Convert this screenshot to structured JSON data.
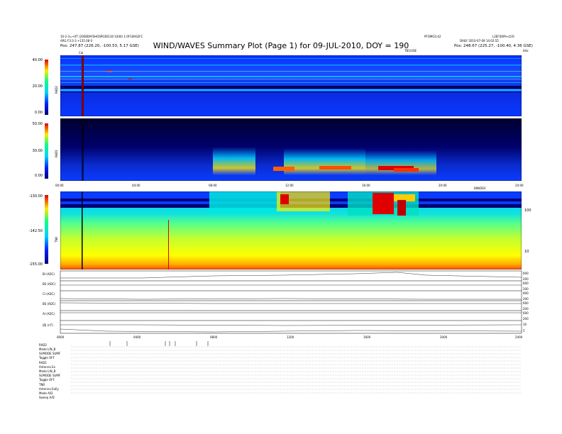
{
  "header": {
    "title": "WIND/WAVES Summary Plot (Page 1) for 09-JUL-2010, DOY = 190",
    "left_line1": "10-2-3=+0T (2008DAYSHOSP03D130 S300) 1:0F10HS2FC",
    "left_line2": "ARG F3:3-3 +135 08 0",
    "left_pos": "Pos: 247.87 (226.20, -100.53, 5.17 GSE)",
    "right_top_a": "PFOMO3.42",
    "right_top_b": "L2EF0OM+s5/0",
    "right_line2": "DAILY 2010-07-09 14:02:55",
    "right_pos": "Pos: 248.67 (225.27, -100.40, 4.36 GSE)",
    "tb_label": "TB1/USE",
    "khz_label": "kHz"
  },
  "panels": {
    "rad2": {
      "name": "RAD2",
      "ticks": [
        "40.00",
        "20.00",
        "0.00"
      ],
      "cal": "Cal"
    },
    "rad1": {
      "name": "RAD1",
      "ticks": [
        "50.00",
        "30.00",
        "0.00"
      ]
    },
    "tnr": {
      "name": "TNR",
      "ticks": [
        "-130.00",
        "-142.50",
        "-155.00"
      ],
      "right_ticks": [
        "100",
        "10"
      ],
      "top_right": "BIN/DEV"
    }
  },
  "time_axis": [
    "00:00",
    "04:00",
    "08:00",
    "12:00",
    "16:00",
    "20:00",
    "24:00"
  ],
  "lines_axis": [
    "0000",
    "0400",
    "0800",
    "1200",
    "1600",
    "2000",
    "2400"
  ],
  "line_rows": [
    {
      "label": "BI (ADC)",
      "r1": "600",
      "r2": "200"
    },
    {
      "label": "BS (ADC)",
      "r1": "600",
      "r2": "200"
    },
    {
      "label": "CI (ADC)",
      "r1": "600",
      "r2": "200"
    },
    {
      "label": "BS (ADC)",
      "r1": "600",
      "r2": "200"
    },
    {
      "label": "AI (ADC)",
      "r1": "600",
      "r2": "200"
    },
    {
      "label": "|B| (nT)",
      "r1": "10",
      "r2": "5"
    }
  ],
  "settings": {
    "rad2": [
      "RAD2",
      "Mode   LIN_B",
      "SUMODE  SUMF",
      "Toggle   OFF"
    ],
    "rad1": [
      "RAD1",
      "Antenna    Ex",
      "Mode   LIN_B",
      "SUMODE SUMF",
      "Toggle   OFF"
    ],
    "tnr": [
      "TNR",
      "Antenna  ExEy",
      "Mode     A/D",
      "Sweep   A/D"
    ]
  },
  "colors": {
    "dark_blue": "#00007a",
    "blue": "#0a2cff",
    "cyan": "#00e0ff",
    "yellow": "#ffea00",
    "red": "#e00000"
  },
  "chart_data": {
    "type": "heatmap",
    "title": "WIND/WAVES Summary Plot (Page 1) for 09-JUL-2010, DOY = 190",
    "x_range_hours": [
      0,
      24
    ],
    "panels": [
      {
        "name": "RAD2",
        "color_scale": [
          0.0,
          40.0
        ]
      },
      {
        "name": "RAD1",
        "color_scale": [
          0.0,
          50.0
        ],
        "enhanced_intervals_hours": [
          [
            8,
            10
          ],
          [
            11.5,
            15.5
          ],
          [
            16,
            19
          ]
        ]
      },
      {
        "name": "TNR",
        "color_scale": [
          -155.0,
          -130.0
        ],
        "right_axis": [
          "100",
          "10"
        ]
      }
    ],
    "event_ticks_hours": [
      2.6,
      3.5,
      5.5,
      5.7,
      6.0,
      7.1,
      7.7
    ],
    "marker_hour": 1.2
  }
}
